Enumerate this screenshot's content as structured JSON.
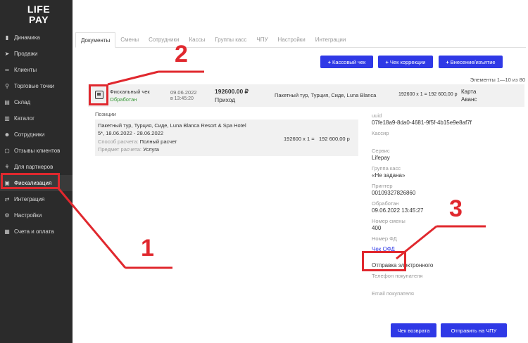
{
  "logo": {
    "line1": "LIFE",
    "line2": "PAY"
  },
  "sidebar": {
    "items": [
      {
        "label": "Динамика",
        "icon": "chart-icon",
        "glyph": "▮"
      },
      {
        "label": "Продажи",
        "icon": "rocket-icon",
        "glyph": "➤"
      },
      {
        "label": "Клиенты",
        "icon": "link-icon",
        "glyph": "∞"
      },
      {
        "label": "Торговые точки",
        "icon": "location-icon",
        "glyph": "⚲"
      },
      {
        "label": "Склад",
        "icon": "warehouse-icon",
        "glyph": "▤"
      },
      {
        "label": "Каталог",
        "icon": "book-icon",
        "glyph": "▥"
      },
      {
        "label": "Сотрудники",
        "icon": "users-icon",
        "glyph": "☻"
      },
      {
        "label": "Отзывы клиентов",
        "icon": "chat-icon",
        "glyph": "▢"
      },
      {
        "label": "Для партнеров",
        "icon": "handshake-icon",
        "glyph": "⚘"
      },
      {
        "label": "Фискализация",
        "icon": "printer-icon",
        "glyph": "▣"
      },
      {
        "label": "Интеграция",
        "icon": "exchange-icon",
        "glyph": "⇄"
      },
      {
        "label": "Настройки",
        "icon": "gear-icon",
        "glyph": "⚙"
      },
      {
        "label": "Счета и оплата",
        "icon": "calculator-icon",
        "glyph": "▦"
      }
    ]
  },
  "tabs": [
    "Документы",
    "Смены",
    "Сотрудники",
    "Кассы",
    "Группы касс",
    "ЧПУ",
    "Настройки",
    "Интеграции"
  ],
  "toolbar": {
    "cash_receipt": "Кассовый чек",
    "correction_receipt": "Чек коррекции",
    "deposit_withdraw": "Внесение/изъятие",
    "plus": "+"
  },
  "elements_count": "Элементы 1—10 из 80",
  "document_row": {
    "type": "Фискальный чек",
    "status": "Обработан",
    "date": "09.06.2022",
    "time": "в 13:45:20",
    "amount": "192600.00 ₽",
    "direction": "Приход",
    "description": "Пакетный тур, Турция, Сиде, Luna Blanca",
    "calc": "192600 x 1 = 192 600,00 р",
    "payment_line1": "Карта",
    "payment_line2": "Аванс"
  },
  "positions": {
    "label": "Позиции",
    "name_line1": "Пакетный тур, Турция, Сиде, Luna Blanca Resort & Spa Hotel",
    "name_line2": "5*, 18.06.2022 - 28.06.2022",
    "method_label": "Способ расчета:",
    "method_value": "Полный расчет",
    "subject_label": "Предмет расчета:",
    "subject_value": "Услуга",
    "calc": "192600 x 1 =",
    "total": "192 600,00 р"
  },
  "details": {
    "uuid_label": "uuid",
    "uuid_value": "07fe18a9-8da0-4681-9f5f-4b15e9e8af7f",
    "cashier_label": "Кассир",
    "cashier_value": "",
    "service_label": "Сервис",
    "service_value": "Lifepay",
    "group_label": "Группа касс",
    "group_value": "«Не задана»",
    "printer_label": "Принтер",
    "printer_value": "00109327826860",
    "processed_label": "Обработан",
    "processed_value": "09.06.2022 13:45:27",
    "shift_label": "Номер смены",
    "shift_value": "400",
    "fd_label": "Номер ФД",
    "ofd_link": "Чек ОФД",
    "send_value": "Отправка электронного",
    "phone_label": "Телефон покупателя",
    "email_label": "Email покупателя"
  },
  "footer": {
    "return_receipt": "Чек возврата",
    "send_chpu": "Отправить на ЧПУ"
  },
  "annotations": {
    "one": "1",
    "two": "2",
    "three": "3"
  },
  "annotation_color": "#e0282e",
  "accent_color": "#2f39e6"
}
